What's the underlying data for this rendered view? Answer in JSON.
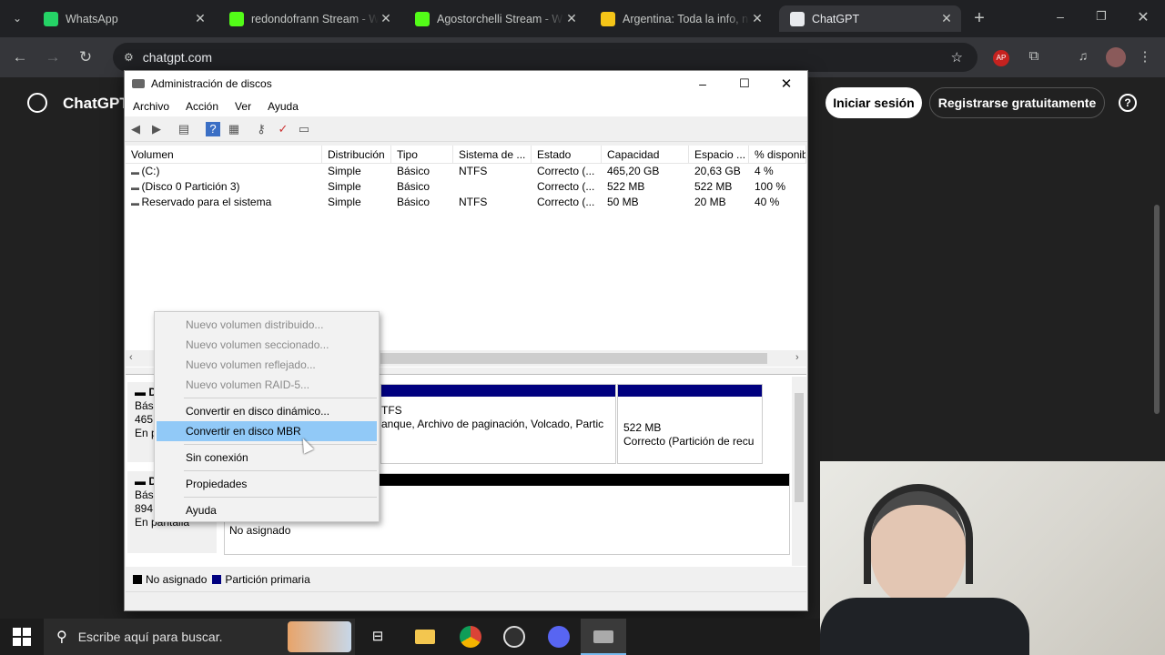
{
  "browser": {
    "tabs": [
      {
        "title": "WhatsApp",
        "icon": "whatsapp-icon",
        "color": "#25d366",
        "active": false
      },
      {
        "title": "redondofrann Stream - W",
        "icon": "kick-icon",
        "color": "#53fc18",
        "active": false
      },
      {
        "title": "Agostorchelli Stream - W",
        "icon": "kick-icon",
        "color": "#53fc18",
        "active": false
      },
      {
        "title": "Argentina: Toda la info, n",
        "icon": "crown-icon",
        "color": "#f5c518",
        "active": false
      },
      {
        "title": "ChatGPT",
        "icon": "chatgpt-icon",
        "color": "#e8eaed",
        "active": true
      }
    ],
    "url": "chatgpt.com"
  },
  "chatgpt": {
    "brand": "ChatGPT",
    "login": "Iniciar sesión",
    "signup": "Registrarse gratuitamente",
    "help": "?"
  },
  "diskmgmt": {
    "title": "Administración de discos",
    "menu": [
      "Archivo",
      "Acción",
      "Ver",
      "Ayuda"
    ],
    "columns": [
      "Volumen",
      "Distribución",
      "Tipo",
      "Sistema de ...",
      "Estado",
      "Capacidad",
      "Espacio ...",
      "% disponib"
    ],
    "rows": [
      [
        "(C:)",
        "Simple",
        "Básico",
        "NTFS",
        "Correcto (...",
        "465,20 GB",
        "20,63 GB",
        "4 %"
      ],
      [
        "(Disco 0 Partición 3)",
        "Simple",
        "Básico",
        "",
        "Correcto (...",
        "522 MB",
        "522 MB",
        "100 %"
      ],
      [
        "Reservado para el sistema",
        "Simple",
        "Básico",
        "NTFS",
        "Correcto (...",
        "50 MB",
        "20 MB",
        "40 %"
      ]
    ],
    "disk0": {
      "label_prefix": "D",
      "type_short": "Bási",
      "size_short": "465,",
      "status_short": "En p",
      "part_c_fs": "TFS",
      "part_c_desc": "anque, Archivo de paginación, Volcado, Partic",
      "part3_size": "522 MB",
      "part3_status": "Correcto (Partición de recu"
    },
    "disk1": {
      "label_prefix": "D",
      "type_short": "Bási",
      "size_short": "894,",
      "status": "En pantalla",
      "unallocated": "No asignado"
    },
    "legend": {
      "unallocated": "No asignado",
      "primary": "Partición primaria"
    },
    "context_menu": [
      {
        "label": "Nuevo volumen distribuido...",
        "disabled": true
      },
      {
        "label": "Nuevo volumen seccionado...",
        "disabled": true
      },
      {
        "label": "Nuevo volumen reflejado...",
        "disabled": true
      },
      {
        "label": "Nuevo volumen RAID-5...",
        "disabled": true
      },
      {
        "label": "Convertir en disco dinámico...",
        "disabled": false
      },
      {
        "label": "Convertir en disco MBR",
        "disabled": false,
        "highlighted": true
      },
      {
        "label": "Sin conexión",
        "disabled": false
      },
      {
        "label": "Propiedades",
        "disabled": false
      },
      {
        "label": "Ayuda",
        "disabled": false
      }
    ]
  },
  "taskbar": {
    "search_placeholder": "Escribe aquí para buscar."
  },
  "colors": {
    "primary_partition": "#00007f",
    "unallocated": "#000000",
    "menu_highlight": "#91c9f7"
  }
}
